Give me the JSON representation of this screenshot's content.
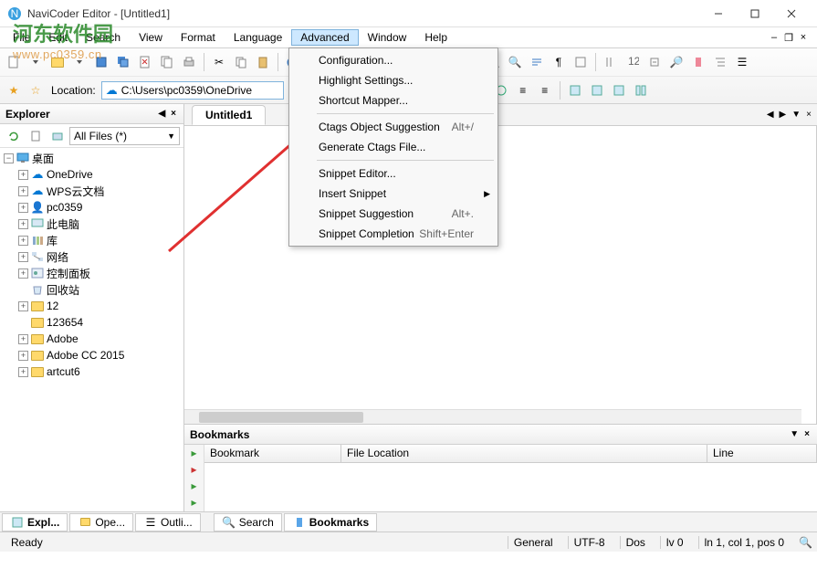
{
  "window": {
    "title": "NaviCoder Editor - [Untitled1]"
  },
  "watermark": {
    "cn": "河东软件园",
    "url": "www.pc0359.cn"
  },
  "menubar": [
    "File",
    "Edit",
    "Search",
    "View",
    "Format",
    "Language",
    "Advanced",
    "Window",
    "Help"
  ],
  "dropdown": {
    "items": [
      {
        "label": "Configuration...",
        "shortcut": ""
      },
      {
        "label": "Highlight Settings...",
        "shortcut": ""
      },
      {
        "label": "Shortcut Mapper...",
        "shortcut": ""
      },
      {
        "sep": true
      },
      {
        "label": "Ctags Object Suggestion",
        "shortcut": "Alt+/"
      },
      {
        "label": "Generate Ctags File...",
        "shortcut": ""
      },
      {
        "sep": true
      },
      {
        "label": "Snippet Editor...",
        "shortcut": ""
      },
      {
        "label": "Insert Snippet",
        "shortcut": "",
        "submenu": true
      },
      {
        "label": "Snippet Suggestion",
        "shortcut": "Alt+."
      },
      {
        "label": "Snippet Completion",
        "shortcut": "Shift+Enter"
      }
    ]
  },
  "location": {
    "label": "Location:",
    "path": "C:\\Users\\pc0359\\OneDrive"
  },
  "explorer": {
    "title": "Explorer",
    "filter": "All Files (*)",
    "root": "桌面",
    "items": [
      {
        "label": "OneDrive",
        "icon": "cloud"
      },
      {
        "label": "WPS云文档",
        "icon": "cloud"
      },
      {
        "label": "pc0359",
        "icon": "user"
      },
      {
        "label": "此电脑",
        "icon": "pc"
      },
      {
        "label": "库",
        "icon": "lib"
      },
      {
        "label": "网络",
        "icon": "net"
      },
      {
        "label": "控制面板",
        "icon": "ctrl"
      },
      {
        "label": "回收站",
        "icon": "bin"
      },
      {
        "label": "12",
        "icon": "folder"
      },
      {
        "label": "123654",
        "icon": "folder"
      },
      {
        "label": "Adobe",
        "icon": "folder"
      },
      {
        "label": "Adobe CC 2015",
        "icon": "folder"
      },
      {
        "label": "artcut6",
        "icon": "folder"
      }
    ]
  },
  "tabs": {
    "active": "Untitled1"
  },
  "bookmarks": {
    "title": "Bookmarks",
    "cols": [
      "Bookmark",
      "File Location",
      "Line"
    ]
  },
  "bottomtabs": {
    "left": [
      "Expl...",
      "Ope...",
      "Outli..."
    ],
    "right": [
      "Search",
      "Bookmarks"
    ]
  },
  "status": {
    "ready": "Ready",
    "general": "General",
    "encoding": "UTF-8",
    "eol": "Dos",
    "level": "lv 0",
    "pos": "ln 1, col 1, pos 0"
  }
}
